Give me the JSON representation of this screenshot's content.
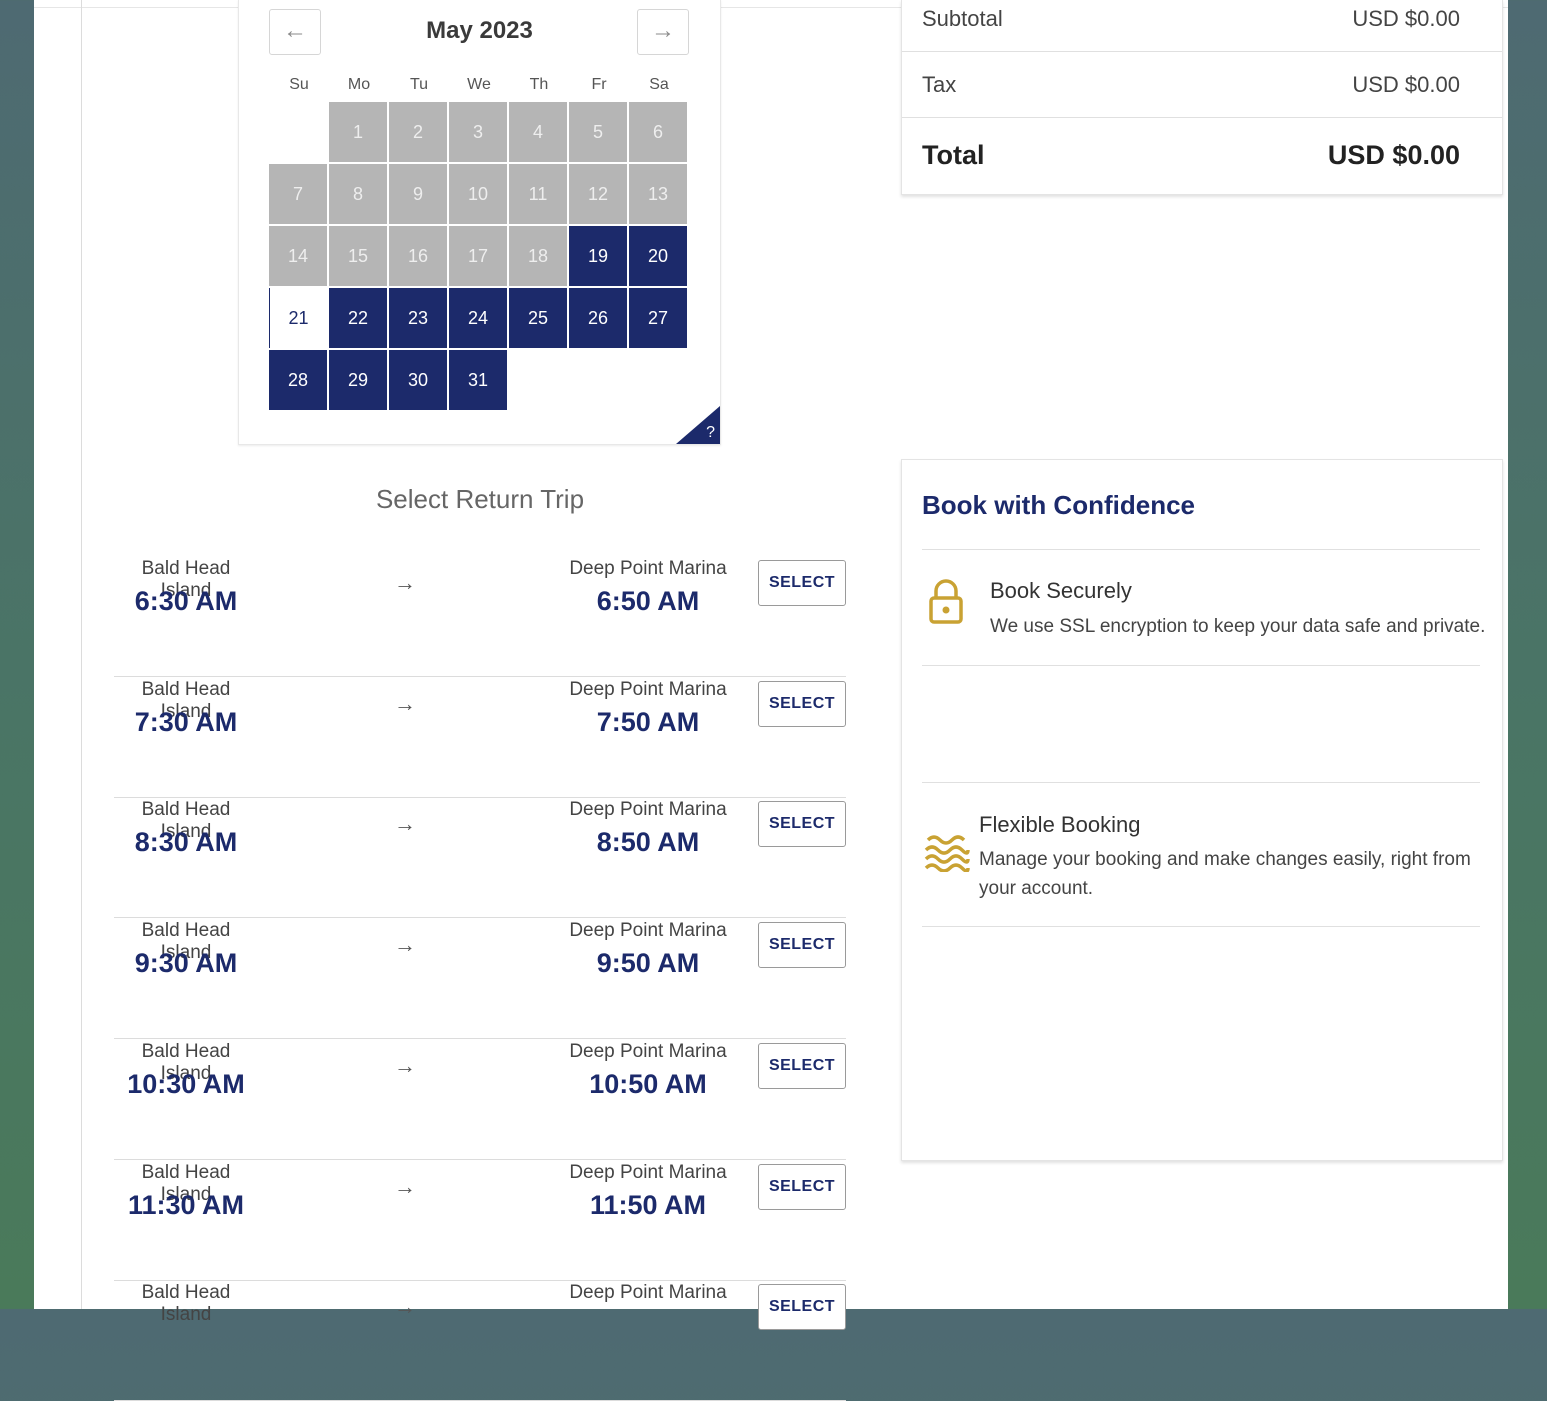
{
  "calendar": {
    "month_label": "May 2023",
    "prev_icon": "arrow-left-icon",
    "next_icon": "arrow-right-icon",
    "prev_glyph": "←",
    "next_glyph": "→",
    "weekdays": [
      "Su",
      "Mo",
      "Tu",
      "We",
      "Th",
      "Fr",
      "Sa"
    ],
    "days": [
      {
        "n": "1",
        "state": "past"
      },
      {
        "n": "2",
        "state": "past"
      },
      {
        "n": "3",
        "state": "past"
      },
      {
        "n": "4",
        "state": "past"
      },
      {
        "n": "5",
        "state": "past"
      },
      {
        "n": "6",
        "state": "past"
      },
      {
        "n": "7",
        "state": "past"
      },
      {
        "n": "8",
        "state": "past"
      },
      {
        "n": "9",
        "state": "past"
      },
      {
        "n": "10",
        "state": "past"
      },
      {
        "n": "11",
        "state": "past"
      },
      {
        "n": "12",
        "state": "past"
      },
      {
        "n": "13",
        "state": "past"
      },
      {
        "n": "14",
        "state": "past"
      },
      {
        "n": "15",
        "state": "past"
      },
      {
        "n": "16",
        "state": "past"
      },
      {
        "n": "17",
        "state": "past"
      },
      {
        "n": "18",
        "state": "past"
      },
      {
        "n": "19",
        "state": "avail"
      },
      {
        "n": "20",
        "state": "avail"
      },
      {
        "n": "21",
        "state": "today"
      },
      {
        "n": "22",
        "state": "avail"
      },
      {
        "n": "23",
        "state": "avail"
      },
      {
        "n": "24",
        "state": "avail"
      },
      {
        "n": "25",
        "state": "avail"
      },
      {
        "n": "26",
        "state": "avail"
      },
      {
        "n": "27",
        "state": "avail"
      },
      {
        "n": "28",
        "state": "avail"
      },
      {
        "n": "29",
        "state": "avail"
      },
      {
        "n": "30",
        "state": "avail"
      },
      {
        "n": "31",
        "state": "avail"
      }
    ],
    "help_label": "?"
  },
  "return_trip": {
    "title": "Select Return Trip",
    "arrow_glyph": "→",
    "select_label": "SELECT",
    "trips": [
      {
        "from": "Bald Head Island",
        "depart": "6:30 AM",
        "to": "Deep Point Marina",
        "arrive": "6:50 AM"
      },
      {
        "from": "Bald Head Island",
        "depart": "7:30 AM",
        "to": "Deep Point Marina",
        "arrive": "7:50 AM"
      },
      {
        "from": "Bald Head Island",
        "depart": "8:30 AM",
        "to": "Deep Point Marina",
        "arrive": "8:50 AM"
      },
      {
        "from": "Bald Head Island",
        "depart": "9:30 AM",
        "to": "Deep Point Marina",
        "arrive": "9:50 AM"
      },
      {
        "from": "Bald Head Island",
        "depart": "10:30 AM",
        "to": "Deep Point Marina",
        "arrive": "10:50 AM"
      },
      {
        "from": "Bald Head Island",
        "depart": "11:30 AM",
        "to": "Deep Point Marina",
        "arrive": "11:50 AM"
      },
      {
        "from": "Bald Head Island",
        "depart": "",
        "to": "Deep Point Marina",
        "arrive": ""
      }
    ]
  },
  "summary": {
    "subtotal_label": "Subtotal",
    "subtotal_value": "USD $0.00",
    "tax_label": "Tax",
    "tax_value": "USD $0.00",
    "total_label": "Total",
    "total_value": "USD $0.00"
  },
  "confidence": {
    "title": "Book with Confidence",
    "secure_title": "Book Securely",
    "secure_desc": "We use SSL encryption to keep your data safe and private.",
    "secure_icon": "lock-icon",
    "flex_title": "Flexible Booking",
    "flex_desc": "Manage your booking and make changes easily, right from your account.",
    "flex_icon": "waves-icon"
  },
  "colors": {
    "brand_navy": "#1c2a6b",
    "accent_gold": "#c9a233",
    "past_day": "#b5b5b5"
  }
}
